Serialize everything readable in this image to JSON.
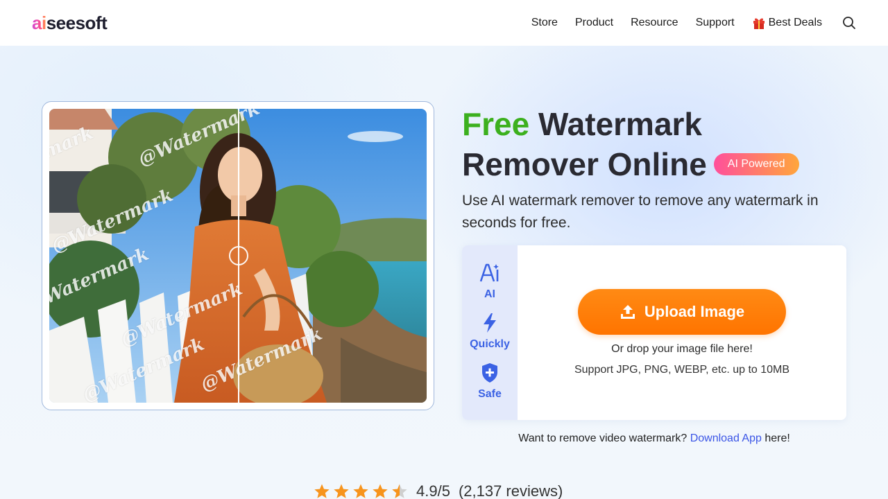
{
  "header": {
    "logo_prefix": "ai",
    "logo_suffix": "seesoft",
    "nav": [
      "Store",
      "Product",
      "Resource",
      "Support"
    ],
    "deals_label": "Best Deals"
  },
  "demo": {
    "watermarks": [
      "@Watermark",
      "@Watermark",
      "@Watermark",
      "@Watermark",
      "@Watermark",
      "@Watermark",
      "@Watermark"
    ]
  },
  "hero": {
    "title_free": "Free",
    "title_rest_1": " Watermark",
    "title_line_2": "Remover Online",
    "badge": "AI Powered",
    "subtitle": "Use AI watermark remover to remove any watermark in seconds for free."
  },
  "features": [
    {
      "icon": "ai-icon",
      "label": "AI"
    },
    {
      "icon": "lightning-icon",
      "label": "Quickly"
    },
    {
      "icon": "shield-plus-icon",
      "label": "Safe"
    }
  ],
  "upload": {
    "button_label": "Upload Image",
    "drop_text": "Or drop your image file here!",
    "support_text": "Support JPG, PNG, WEBP, etc. up to 10MB"
  },
  "video_line": {
    "before": "Want to remove video watermark? ",
    "link": "Download App",
    "after": " here!"
  },
  "rating": {
    "stars": 4.5,
    "value": "4.9/5",
    "count": "(2,137 reviews)"
  },
  "colors": {
    "free_green": "#3cb01e",
    "upload_orange": "#ff7a00",
    "feature_blue": "#3b62e4",
    "link_blue": "#3b55e6",
    "star_orange": "#f7941d"
  }
}
